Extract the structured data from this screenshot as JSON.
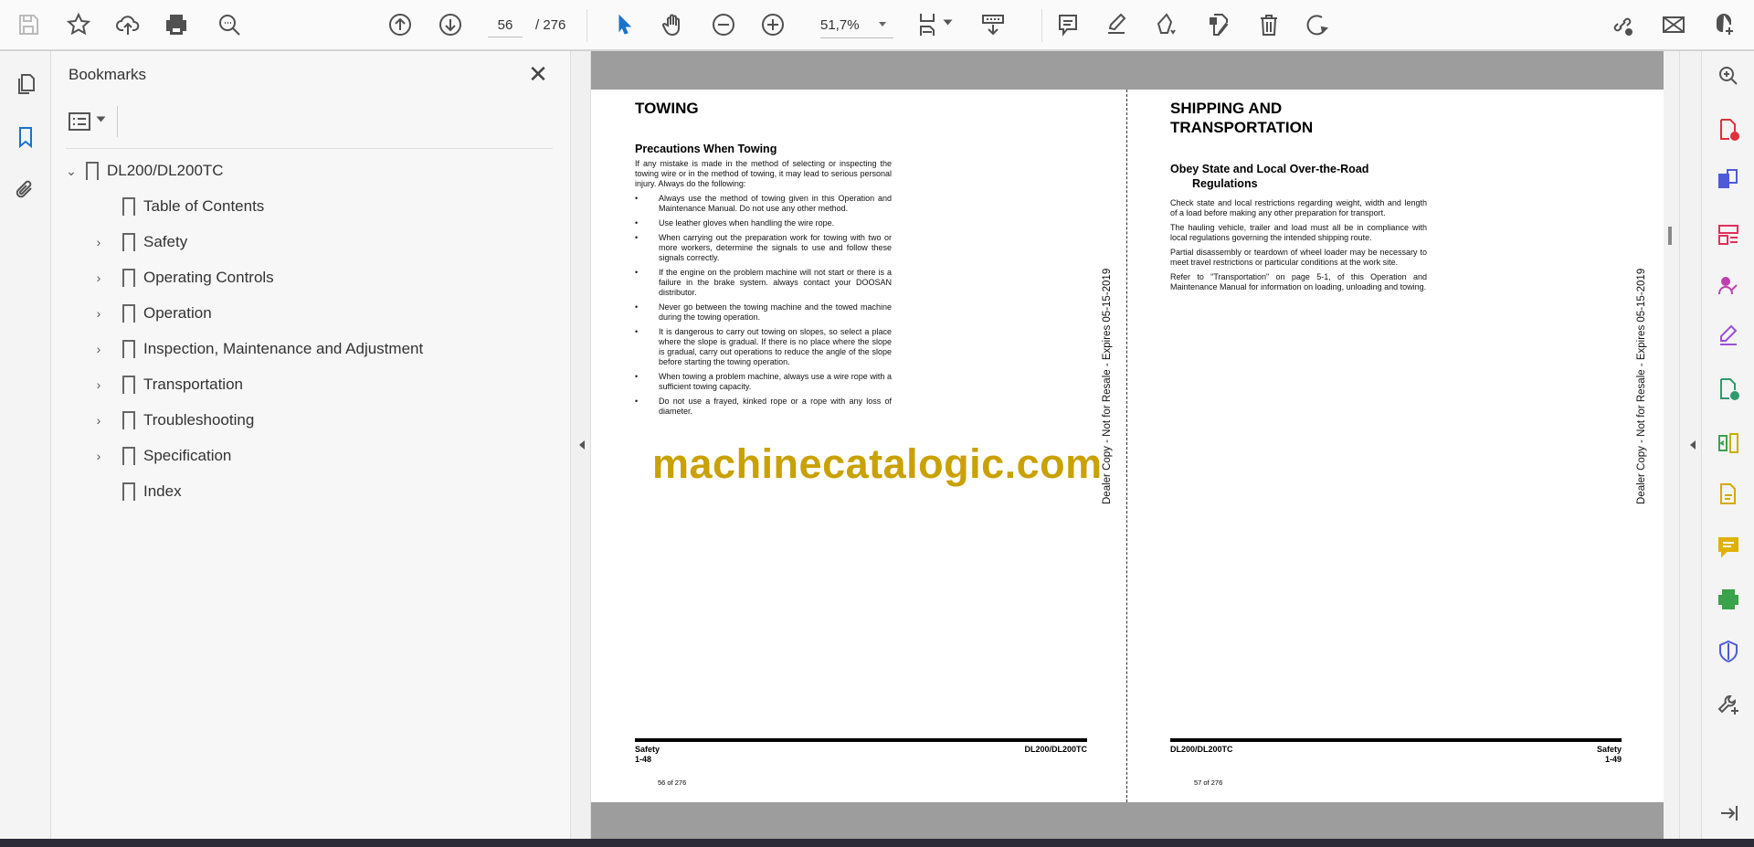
{
  "toolbar": {
    "current_page": "56",
    "total_pages": "/ 276",
    "zoom_level": "51,7%",
    "icons": [
      "save-icon",
      "bookmark-star-icon",
      "upload-cloud-icon",
      "print-icon",
      "find-icon",
      "previous-page-icon",
      "next-page-icon",
      "select-cursor-icon",
      "hand-icon",
      "zoom-out-icon",
      "zoom-in-icon",
      "fit-page-icon",
      "scroll-mode-icon",
      "comment-icon",
      "highlight-icon",
      "sign-icon",
      "edit-pdf-icon",
      "delete-icon",
      "rotate-icon",
      "share-link-icon",
      "email-icon",
      "add-user-icon"
    ]
  },
  "bookmarks": {
    "title": "Bookmarks",
    "root": "DL200/DL200TC",
    "items": [
      {
        "label": "Table of Contents",
        "expandable": false
      },
      {
        "label": "Safety",
        "expandable": true
      },
      {
        "label": "Operating Controls",
        "expandable": true
      },
      {
        "label": "Operation",
        "expandable": true
      },
      {
        "label": "Inspection, Maintenance and Adjustment",
        "expandable": true
      },
      {
        "label": "Transportation",
        "expandable": true
      },
      {
        "label": "Troubleshooting",
        "expandable": true
      },
      {
        "label": "Specification",
        "expandable": true
      },
      {
        "label": "Index",
        "expandable": false
      }
    ]
  },
  "left_page": {
    "title": "TOWING",
    "subtitle": "Precautions When Towing",
    "intro": "If any mistake is made in the method of selecting or inspecting the towing wire or in the method of towing, it may lead to serious personal injury. Always do the following:",
    "bullet_char": "•",
    "bullets": [
      "Always use the method of towing given in this Operation and Maintenance Manual. Do not use any other method.",
      "Use leather gloves when handling the wire rope.",
      "When carrying out the preparation work for towing with two or more workers, determine the signals to use and follow these signals correctly.",
      "If the engine on the problem machine will not start or there is a failure in the brake system. always contact your DOOSAN distributor.",
      "Never go between the towing machine and the towed machine during the towing operation.",
      "It is dangerous to carry out towing on slopes, so select a place where the slope is gradual. If there is no place where the slope is gradual, carry out operations to reduce the angle of the slope before starting the towing operation.",
      "When towing a problem machine, always use a wire rope with a sufficient towing capacity.",
      "Do not use a frayed, kinked rope or a rope with any loss of diameter."
    ],
    "side_note": "Dealer Copy - Not for Resale - Expires 05-15-2019",
    "footer_section": "Safety",
    "footer_page": "1-48",
    "footer_model": "DL200/DL200TC",
    "page_counter": "56 of 276"
  },
  "right_page": {
    "title_line1": "SHIPPING AND",
    "title_line2": "TRANSPORTATION",
    "subtitle_line1": "Obey State and Local Over-the-Road",
    "subtitle_line2": "Regulations",
    "paragraphs": [
      "Check state and local restrictions regarding weight, width and length of a load before making any other preparation for transport.",
      "The hauling vehicle, trailer and load must all be in compliance with local regulations governing the intended shipping route.",
      "Partial disassembly or teardown of wheel loader may be necessary to meet travel restrictions or particular conditions at the work site.",
      "Refer to \"Transportation\" on page 5-1, of this Operation and Maintenance Manual for information on loading, unloading and towing."
    ],
    "side_note": "Dealer Copy - Not for Resale - Expires 05-15-2019",
    "footer_model": "DL200/DL200TC",
    "footer_section": "Safety",
    "footer_page": "1-49",
    "page_counter": "57 of 276"
  },
  "watermark": "machinecatalogic.com",
  "right_tools": {
    "colors": [
      "#555555",
      "#e0303a",
      "#4d5bd8",
      "#e0305a",
      "#c03fb0",
      "#9a4fd8",
      "#2f9a6a",
      "#c9b000",
      "#d8a800",
      "#e0b000",
      "#3aa24a",
      "#4d5bd8",
      "#555555"
    ]
  }
}
